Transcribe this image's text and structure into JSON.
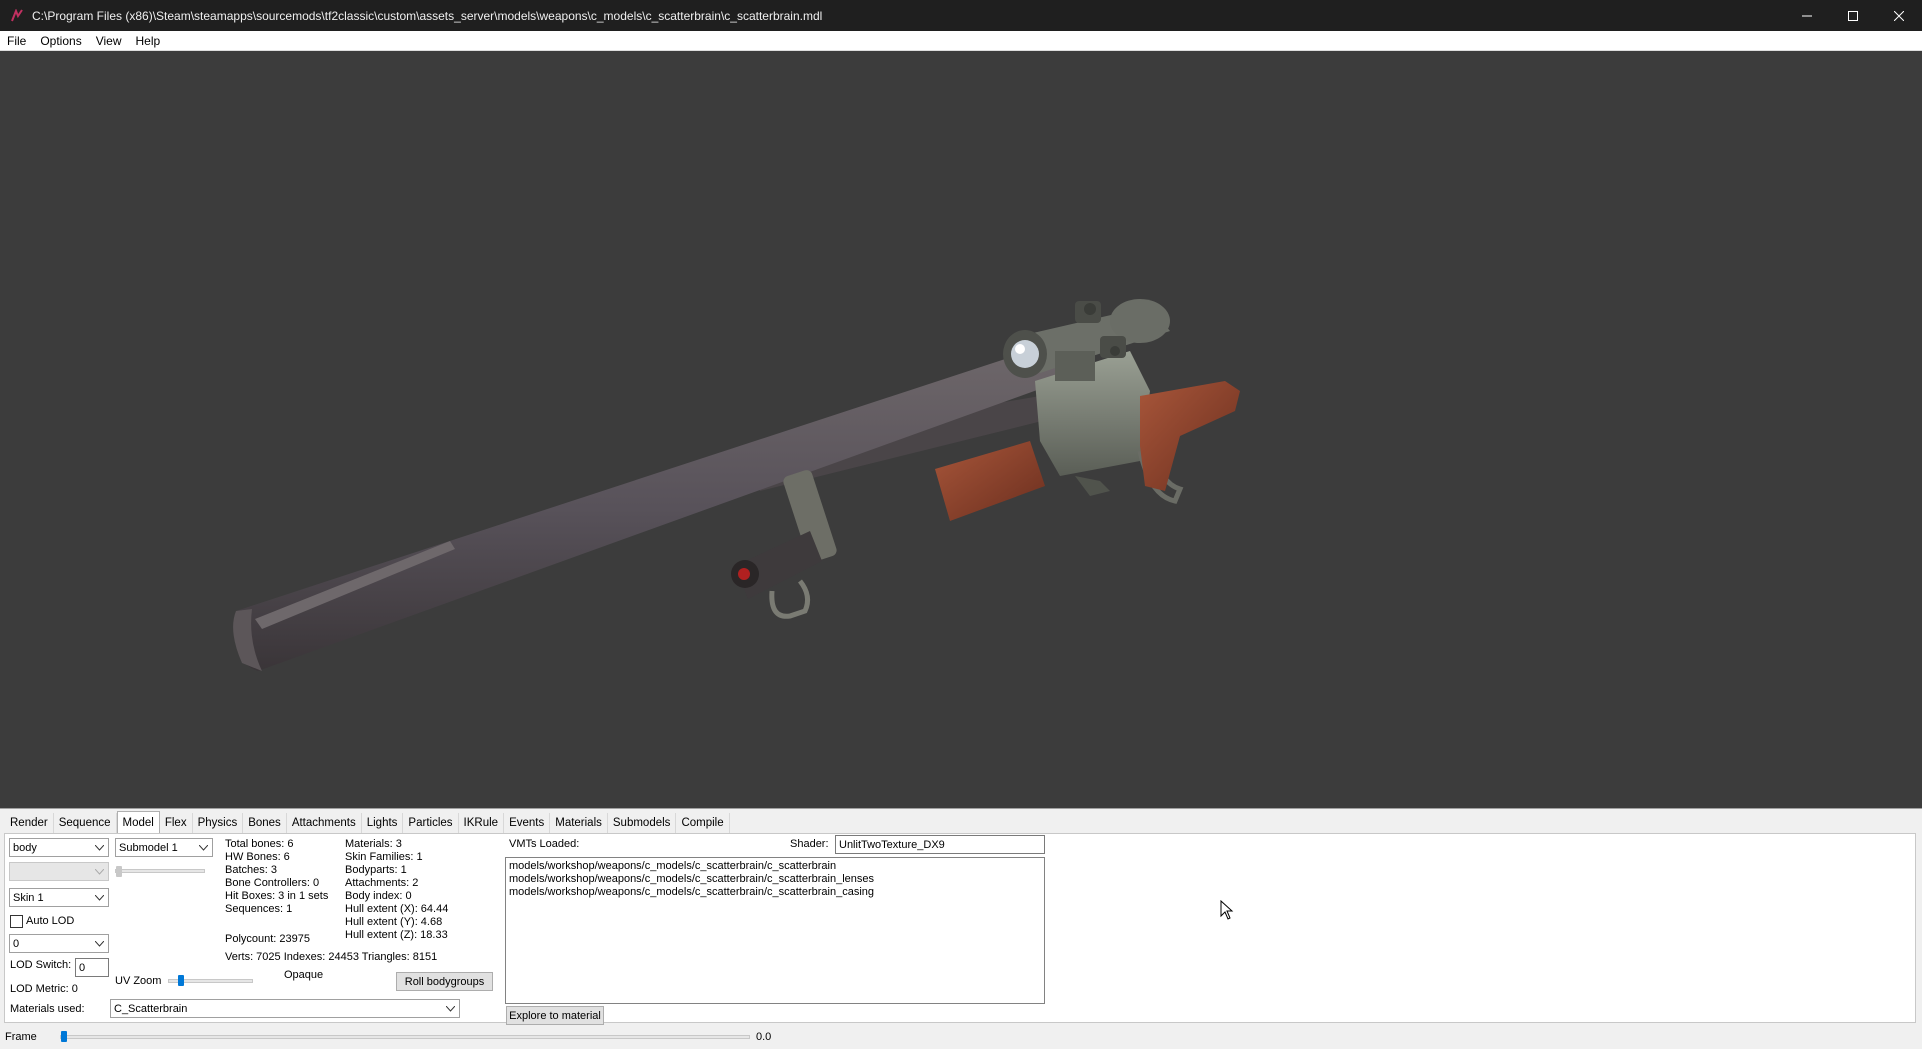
{
  "window": {
    "title": "C:\\Program Files (x86)\\Steam\\steamapps\\sourcemods\\tf2classic\\custom\\assets_server\\models\\weapons\\c_models\\c_scatterbrain\\c_scatterbrain.mdl",
    "minimize_glyph": "—",
    "maximize_glyph": "☐",
    "close_glyph": "✕"
  },
  "menu": [
    "File",
    "Options",
    "View",
    "Help"
  ],
  "tabs": [
    {
      "label": "Render"
    },
    {
      "label": "Sequence"
    },
    {
      "label": "Model",
      "active": true
    },
    {
      "label": "Flex"
    },
    {
      "label": "Physics"
    },
    {
      "label": "Bones"
    },
    {
      "label": "Attachments"
    },
    {
      "label": "Lights"
    },
    {
      "label": "Particles"
    },
    {
      "label": "IKRule"
    },
    {
      "label": "Events"
    },
    {
      "label": "Materials"
    },
    {
      "label": "Submodels"
    },
    {
      "label": "Compile"
    }
  ],
  "model": {
    "bodypart_select": "body",
    "submodel_select": "Submodel 1",
    "skin_select": "Skin 1",
    "auto_lod_label": "Auto LOD",
    "auto_lod_checked": false,
    "lod_select": "0",
    "lod_switch_label": "LOD Switch:",
    "lod_switch_value": "0",
    "lod_metric": "LOD Metric:  0",
    "uv_zoom_label": "UV Zoom",
    "uv_zoom_level": 0.25,
    "materials_used_label": "Materials used:",
    "materials_used_value": "C_Scatterbrain",
    "stats_col1": [
      "Total bones: 6",
      "HW Bones: 6",
      "Batches: 3",
      "Bone Controllers: 0",
      "Hit Boxes: 3 in 1 sets",
      "Sequences: 1"
    ],
    "stats_col2": [
      "Materials: 3",
      "Skin Families: 1",
      "Bodyparts: 1",
      "Attachments: 2",
      "Body index: 0",
      "Hull extent (X): 64.44",
      "Hull extent (Y): 4.68",
      "Hull extent (Z): 18.33"
    ],
    "polycount": "Polycount: 23975",
    "verts_line": "Verts: 7025  Indexes: 24453  Triangles: 8151",
    "opaque_label": "Opaque",
    "roll_bodygroups_label": "Roll bodygroups",
    "vmts_loaded_label": "VMTs Loaded:",
    "shader_label": "Shader:",
    "shader_value": "UnlitTwoTexture_DX9",
    "vmts": [
      "models/workshop/weapons/c_models/c_scatterbrain/c_scatterbrain",
      "models/workshop/weapons/c_models/c_scatterbrain/c_scatterbrain_lenses",
      "models/workshop/weapons/c_models/c_scatterbrain/c_scatterbrain_casing"
    ],
    "explore_label": "Explore to material"
  },
  "frame": {
    "label": "Frame",
    "value": "0.0",
    "position": 0.0
  },
  "colors": {
    "viewport_bg": "#3c3c3c",
    "accent": "#0078d7"
  }
}
